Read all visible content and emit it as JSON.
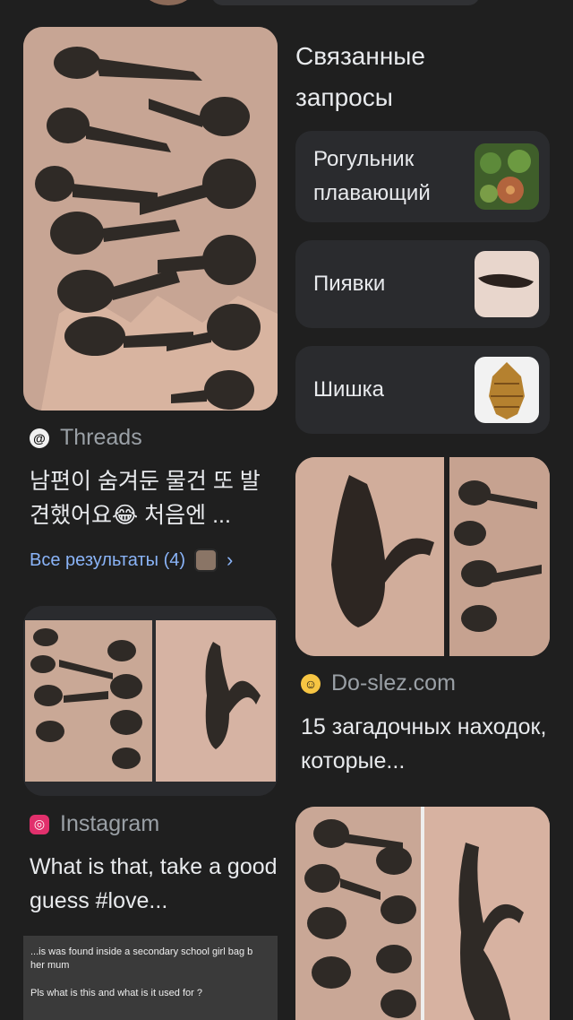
{
  "colors": {
    "background": "#1f1f1f",
    "card": "#2a2b2e",
    "link": "#8ab4f8",
    "muted": "#9aa0a6"
  },
  "left_column": {
    "result1": {
      "source": "Threads",
      "source_icon": "threads-icon",
      "title": "남편이 숨겨둔 물건 또 발견했어요😂 처음엔 ..."
    },
    "more_results": {
      "label": "Все результаты (4)",
      "chevron": "›"
    },
    "result2": {
      "source": "Instagram",
      "source_icon": "instagram-icon",
      "title": "What is that, take a good guess #love..."
    },
    "result3_caption": {
      "line1": "...is was found inside a secondary school girl bag b",
      "line2": "her mum",
      "line3": "Pls what is this and what is it used for ?"
    }
  },
  "right_column": {
    "related_heading": "Связанные запросы",
    "related": [
      {
        "label": "Рогульник плавающий",
        "icon": "water-chestnut-thumb"
      },
      {
        "label": "Пиявки",
        "icon": "leech-thumb"
      },
      {
        "label": "Шишка",
        "icon": "pinecone-thumb"
      }
    ],
    "result4": {
      "source": "Do-slez.com",
      "source_icon": "laughing-emoji-icon",
      "title": "15 загадочных находок, которые..."
    }
  }
}
